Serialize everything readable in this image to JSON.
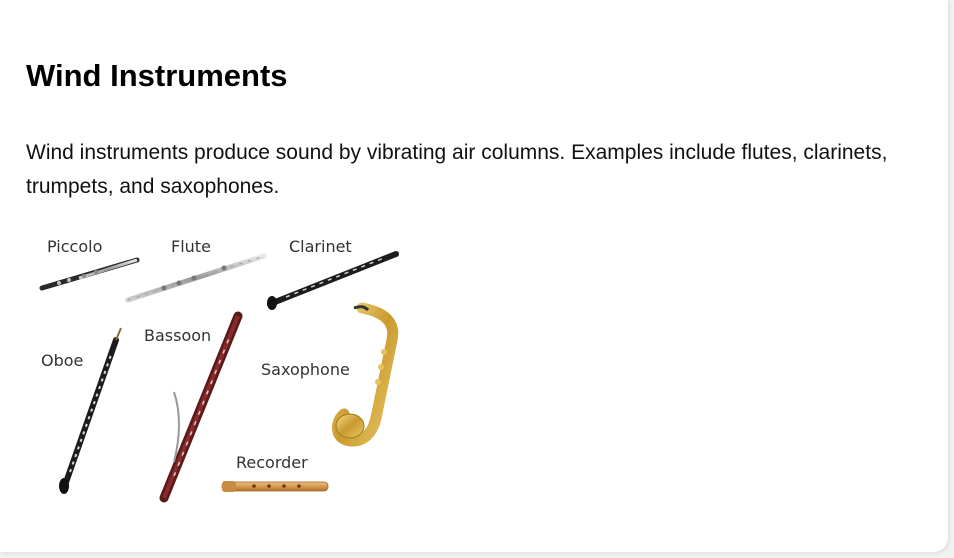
{
  "section": {
    "title": "Wind Instruments",
    "description": "Wind instruments produce sound by vibrating air columns. Examples include flutes, clarinets, trumpets, and saxophones."
  },
  "figure": {
    "labels": {
      "piccolo": "Piccolo",
      "flute": "Flute",
      "clarinet": "Clarinet",
      "oboe": "Oboe",
      "bassoon": "Bassoon",
      "saxophone": "Saxophone",
      "recorder": "Recorder"
    }
  }
}
